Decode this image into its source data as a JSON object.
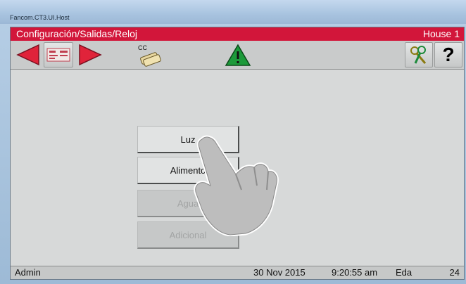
{
  "window": {
    "title": "Fancom.CT3.UI.Host"
  },
  "header": {
    "breadcrumb": "Configuración/Salidas/Reloj",
    "house": "House 1"
  },
  "toolbar": {
    "cc_label": "CC",
    "help_label": "?"
  },
  "menu": {
    "items": [
      {
        "label": "Luz",
        "enabled": true
      },
      {
        "label": "Alimento",
        "enabled": true
      },
      {
        "label": "Agua",
        "enabled": false
      },
      {
        "label": "Adicional",
        "enabled": false
      }
    ]
  },
  "status": {
    "user": "Admin",
    "date": "30 Nov 2015",
    "time": "9:20:55 am",
    "code": "Eda",
    "number": "24"
  },
  "colors": {
    "accent": "#d2163a",
    "arrow": "#e0233a",
    "warning": "#1c9a3a"
  }
}
